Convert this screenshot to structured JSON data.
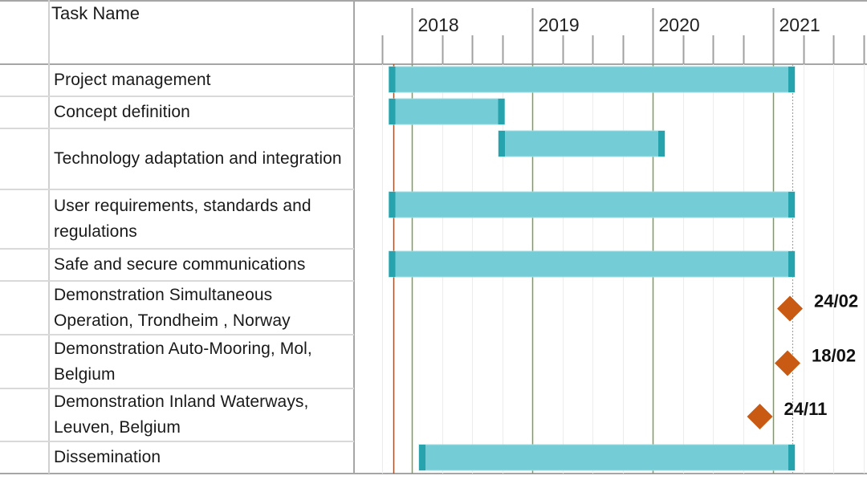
{
  "table": {
    "header": {
      "task_name": "Task Name"
    },
    "rows": [
      {
        "name": "Project management"
      },
      {
        "name": "Concept definition"
      },
      {
        "name": "Technology adaptation and integration"
      },
      {
        "name": "User requirements, standards and regulations"
      },
      {
        "name": "Safe and secure communications"
      },
      {
        "name": "Demonstration Simultaneous Operation, Trondheim , Norway"
      },
      {
        "name": "Demonstration Auto-Mooring, Mol, Belgium"
      },
      {
        "name": "Demonstration Inland Waterways, Leuven, Belgium"
      },
      {
        "name": "Dissemination"
      }
    ]
  },
  "colors": {
    "bar_fill": "#74cdd6",
    "bar_end": "#27a3ad",
    "milestone": "#c95a13",
    "year_line": "#7b9e57",
    "start_line": "#a0522d",
    "grid": "#ececec",
    "axis": "#a0a0a0"
  },
  "chart_data": {
    "type": "gantt",
    "title": "",
    "timeline": {
      "unit": "year",
      "start": 2017.6,
      "end": 2021.75,
      "major_ticks": [
        2018,
        2019,
        2020,
        2021
      ],
      "major_labels": [
        "2018",
        "2019",
        "2020",
        "2021"
      ],
      "minor_tick_interval": 0.25
    },
    "markers": [
      {
        "name": "project-start-line",
        "date": 2017.85,
        "style": "solid-brown"
      },
      {
        "name": "today-line",
        "date": 2021.16,
        "style": "dotted-gray"
      }
    ],
    "tasks": [
      {
        "name": "Project management",
        "type": "bar",
        "start": 2017.81,
        "end": 2021.18
      },
      {
        "name": "Concept definition",
        "type": "bar",
        "start": 2017.81,
        "end": 2018.77
      },
      {
        "name": "Technology adaptation and integration",
        "type": "bar",
        "start": 2018.72,
        "end": 2020.1
      },
      {
        "name": "User requirements, standards and regulations",
        "type": "bar",
        "start": 2017.81,
        "end": 2021.18
      },
      {
        "name": "Safe and secure communications",
        "type": "bar",
        "start": 2017.81,
        "end": 2021.18
      },
      {
        "name": "Demonstration Simultaneous Operation, Trondheim , Norway",
        "type": "milestone",
        "date": 2021.14,
        "label": "24/02"
      },
      {
        "name": "Demonstration Auto-Mooring, Mol, Belgium",
        "type": "milestone",
        "date": 2021.12,
        "label": "18/02"
      },
      {
        "name": "Demonstration Inland Waterways, Leuven, Belgium",
        "type": "milestone",
        "date": 2020.89,
        "label": "24/11"
      },
      {
        "name": "Dissemination",
        "type": "bar",
        "start": 2018.06,
        "end": 2021.18
      }
    ]
  }
}
